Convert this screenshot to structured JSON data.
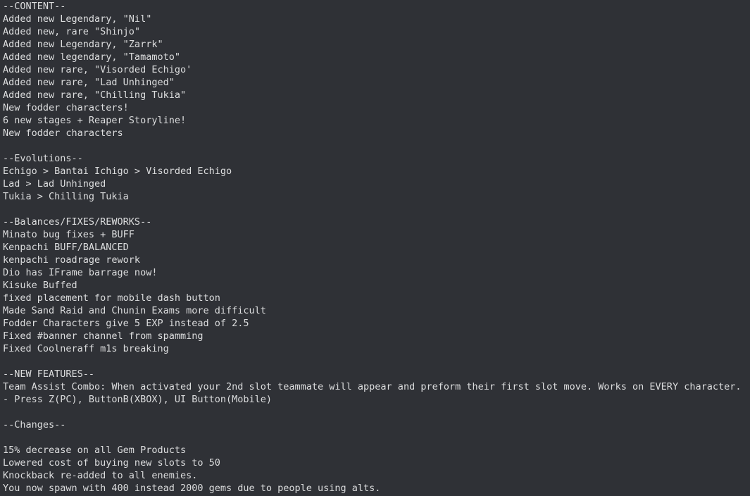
{
  "document": {
    "type": "patch-notes",
    "background_color": "#2f3136",
    "text_color": "#dcddde",
    "lines": [
      "--CONTENT--",
      "Added new Legendary, \"Nil\"",
      "Added new, rare \"Shinjo\"",
      "Added new Legendary, \"Zarrk\"",
      "Added new legendary, \"Tamamoto\"",
      "Added new rare, \"Visorded Echigo'",
      "Added new rare, \"Lad Unhinged\"",
      "Added new rare, \"Chilling Tukia\"",
      "New fodder characters!",
      "6 new stages + Reaper Storyline!",
      "New fodder characters",
      "",
      "--Evolutions--",
      "Echigo > Bantai Ichigo > Visorded Echigo",
      "Lad > Lad Unhinged",
      "Tukia > Chilling Tukia",
      "",
      "--Balances/FIXES/REWORKS--",
      "Minato bug fixes + BUFF",
      "Kenpachi BUFF/BALANCED",
      "kenpachi roadrage rework",
      "Dio has IFrame barrage now!",
      "Kisuke Buffed",
      "fixed placement for mobile dash button",
      "Made Sand Raid and Chunin Exams more difficult",
      "Fodder Characters give 5 EXP instead of 2.5",
      "Fixed #banner channel from spamming",
      "Fixed Coolneraff m1s breaking",
      "",
      "--NEW FEATURES--",
      "Team Assist Combo: When activated your 2nd slot teammate will appear and preform their first slot move. Works on EVERY character. - Press Z(PC), ButtonB(XBOX), UI Button(Mobile)",
      "",
      "--Changes--",
      "",
      "15% decrease on all Gem Products",
      "Lowered cost of buying new slots to 50",
      "Knockback re-added to all enemies.",
      "You now spawn with 400 instead 2000 gems due to people using alts."
    ]
  }
}
